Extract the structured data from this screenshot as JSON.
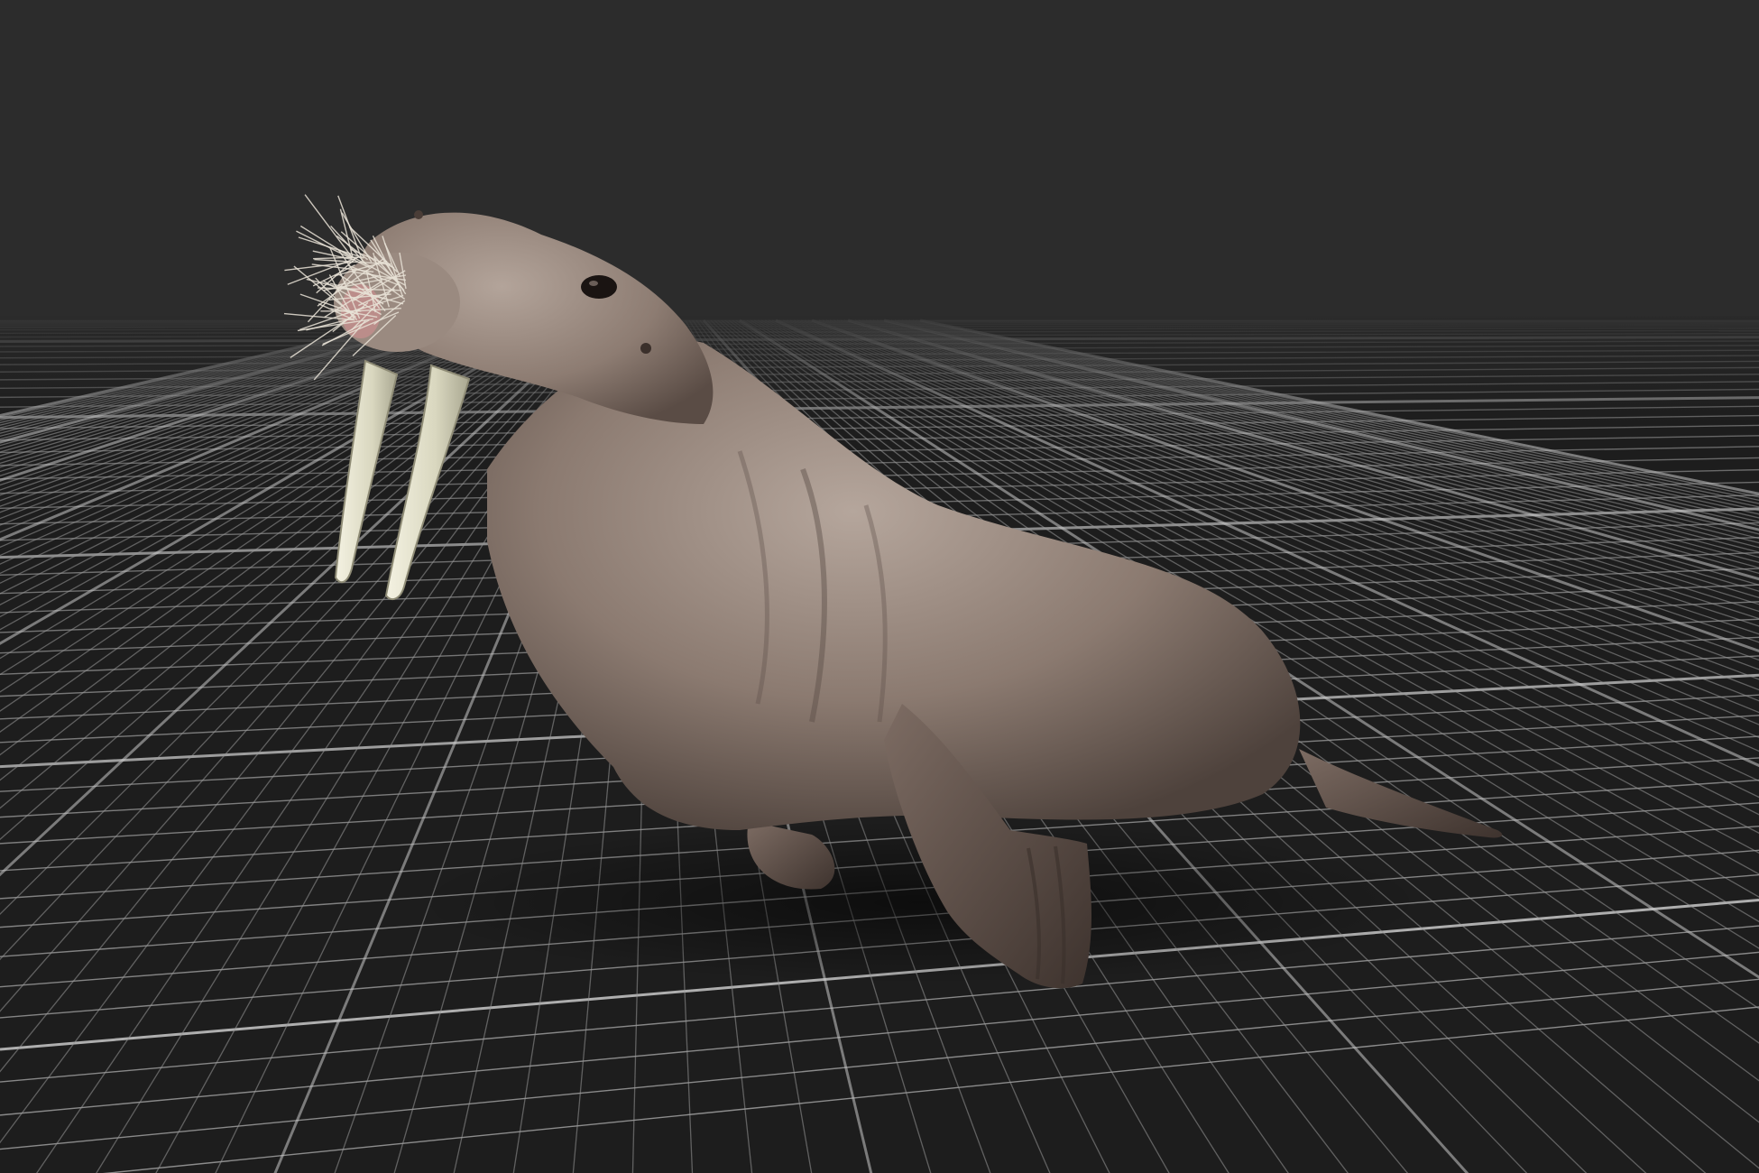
{
  "viewport": {
    "background_color": "#2b2b2b",
    "floor_color": "#1f1f1f",
    "grid_color": "#9a9a9a",
    "grid_major_color": "#c8c8c8",
    "grid_visible": true
  },
  "model": {
    "subject": "walrus",
    "skin_color": "#8b7a70",
    "skin_highlight_color": "#a99a90",
    "skin_shadow_color": "#4e423c",
    "tusk_color": "#e6e4cf",
    "whisker_color": "#e8e2d6",
    "eye_color": "#1a1412"
  }
}
